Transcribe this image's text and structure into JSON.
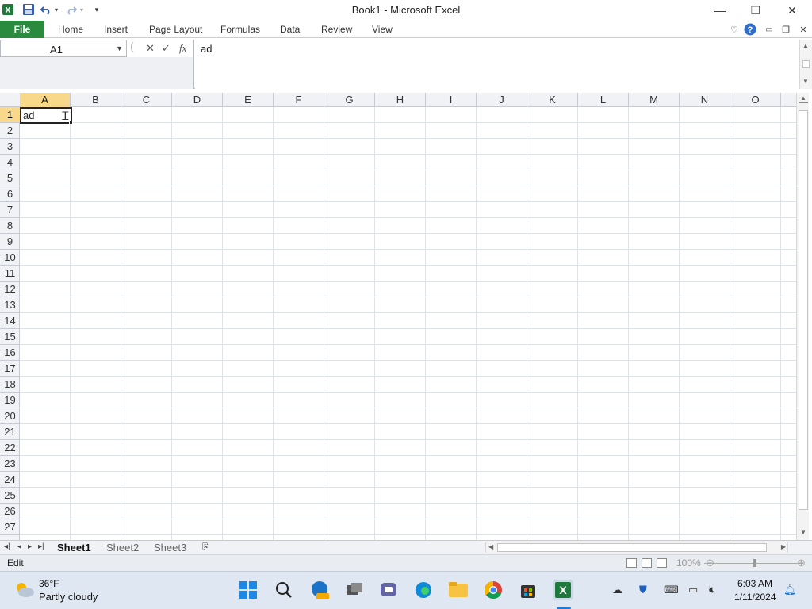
{
  "window": {
    "title": "Book1 - Microsoft Excel"
  },
  "qat": {
    "save_icon": "save-icon",
    "undo_icon": "undo-icon",
    "redo_icon": "redo-icon"
  },
  "window_controls": {
    "minimize": "—",
    "restore": "❐",
    "close": "✕"
  },
  "ribbon": {
    "file_tab": "File",
    "tabs": [
      "Home",
      "Insert",
      "Page Layout",
      "Formulas",
      "Data",
      "Review",
      "View"
    ]
  },
  "formula_bar": {
    "name_box": "A1",
    "cancel_glyph": "✕",
    "enter_glyph": "✓",
    "fx_glyph": "fx",
    "content": "ad"
  },
  "grid": {
    "columns": [
      "A",
      "B",
      "C",
      "D",
      "E",
      "F",
      "G",
      "H",
      "I",
      "J",
      "K",
      "L",
      "M",
      "N",
      "O"
    ],
    "rows": [
      "1",
      "2",
      "3",
      "4",
      "5",
      "6",
      "7",
      "8",
      "9",
      "10",
      "11",
      "12",
      "13",
      "14",
      "15",
      "16",
      "17",
      "18",
      "19",
      "20",
      "21",
      "22",
      "23",
      "24",
      "25",
      "26",
      "27"
    ],
    "active_cell": "A1",
    "active_cell_value": "ad"
  },
  "sheet_tabs": {
    "tabs": [
      "Sheet1",
      "Sheet2",
      "Sheet3"
    ],
    "active": "Sheet1"
  },
  "status_bar": {
    "mode": "Edit",
    "zoom": "100%"
  },
  "taskbar": {
    "weather_temp": "36°F",
    "weather_desc": "Partly cloudy",
    "time": "6:03 AM",
    "date": "1/11/2024"
  },
  "colors": {
    "file_tab": "#2a8a3e",
    "header_selected": "#f8d98b"
  }
}
